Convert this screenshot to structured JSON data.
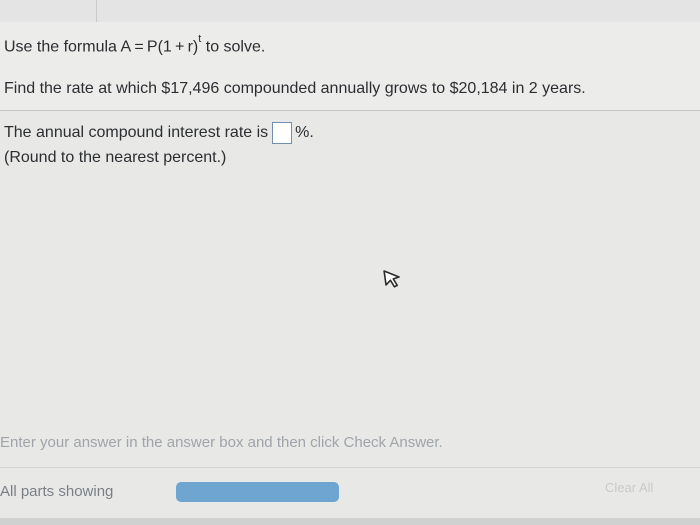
{
  "question": {
    "formula_prefix": "Use the formula A = P(1 + r)",
    "formula_exponent": "t",
    "formula_suffix": " to solve.",
    "task": "Find the rate at which $17,496 compounded annually grows to $20,184 in 2 years."
  },
  "answer": {
    "prompt_before": "The annual compound interest rate is",
    "value": "",
    "unit": "%.",
    "rounding_note": "(Round to the nearest percent.)"
  },
  "footer": {
    "instruction": "Enter your answer in the answer box and then click Check Answer.",
    "status": "All parts showing",
    "clear_all_label": "Clear All"
  }
}
